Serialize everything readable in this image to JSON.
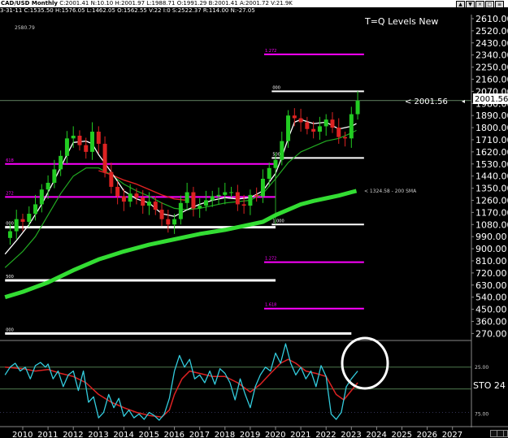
{
  "header": {
    "title": "CAD/USD  Monthly",
    "ohlc": "C:2001.41  N:10.10  H:2001.97  L:1988.71  O:1991.29  B:2001.41  A:2001.72  V:21.9K",
    "subline": "3-31-11  C:1535.50  H:1576.05  L:1462.05  O:1562.55  V:22 I:0  S:2522.37  R:114.00  N:-27.05",
    "window_buttons": [
      "▲",
      "▼",
      "×",
      "□",
      "≡"
    ]
  },
  "chart_data": {
    "type": "candlestick",
    "title": "T=Q Levels New",
    "corner_value": "2580.79",
    "price_label": "< 2001.56",
    "price_tag": "2001.56",
    "sma_label": "<  1324.58 - 200 SMA",
    "oscillator_label": "STO  24",
    "x_ticks": [
      "2010",
      "2011",
      "2012",
      "2013",
      "2014",
      "2015",
      "2016",
      "2017",
      "2018",
      "2019",
      "2020",
      "2021",
      "2022",
      "2023",
      "2024",
      "2025",
      "2026",
      "2027"
    ],
    "y_ticks": [
      2610,
      2520,
      2430,
      2340,
      2250,
      2160,
      2070,
      1980,
      1890,
      1800,
      1710,
      1620,
      1530,
      1440,
      1350,
      1260,
      1170,
      1080,
      990,
      900,
      810,
      720,
      630,
      540,
      450,
      360,
      270
    ],
    "ylim": [
      230,
      2640
    ],
    "osc_ticks": [
      "25.00",
      "75.00"
    ],
    "osc_ylim": [
      0,
      100
    ],
    "levels": [
      {
        "value": 2345,
        "x0": 2019.55,
        "x1": 2023.5,
        "color": "#ff00ff",
        "label": "1.272"
      },
      {
        "value": 2070,
        "x0": 2019.85,
        "x1": 2023.5,
        "color": "#ffffff",
        "label": "000"
      },
      {
        "value": 1575,
        "x0": 2019.85,
        "x1": 2023.5,
        "color": "#ffffff",
        "label": "500"
      },
      {
        "value": 1080,
        "x0": 2019.85,
        "x1": 2023.5,
        "color": "#ffffff",
        "label": "1.000"
      },
      {
        "value": 800,
        "x0": 2019.55,
        "x1": 2023.5,
        "color": "#ff00ff",
        "label": "1.272"
      },
      {
        "value": 455,
        "x0": 2019.55,
        "x1": 2023.5,
        "color": "#ff00ff",
        "label": "1.618"
      },
      {
        "value": 1530,
        "x0": 2009.3,
        "x1": 2020.0,
        "color": "#ff00ff",
        "label": "618"
      },
      {
        "value": 1285,
        "x0": 2009.3,
        "x1": 2020.0,
        "color": "#ff00ff",
        "label": "272"
      },
      {
        "value": 1060,
        "x0": 2009.3,
        "x1": 2020.0,
        "color": "#ffffff",
        "label": "000"
      },
      {
        "value": 665,
        "x0": 2009.3,
        "x1": 2020.0,
        "color": "#ffffff",
        "label": "500"
      },
      {
        "value": 270,
        "x0": 2009.3,
        "x1": 2023.0,
        "color": "#ffffff",
        "label": "000"
      }
    ],
    "close_series": [
      [
        2009.3,
        980
      ],
      [
        2009.5,
        1030
      ],
      [
        2009.75,
        1120
      ],
      [
        2010.0,
        1100
      ],
      [
        2010.25,
        1160
      ],
      [
        2010.5,
        1230
      ],
      [
        2010.75,
        1340
      ],
      [
        2011.0,
        1390
      ],
      [
        2011.25,
        1490
      ],
      [
        2011.5,
        1590
      ],
      [
        2011.75,
        1720
      ],
      [
        2012.0,
        1740
      ],
      [
        2012.25,
        1670
      ],
      [
        2012.5,
        1620
      ],
      [
        2012.75,
        1770
      ],
      [
        2013.0,
        1680
      ],
      [
        2013.25,
        1470
      ],
      [
        2013.5,
        1360
      ],
      [
        2013.75,
        1290
      ],
      [
        2014.0,
        1250
      ],
      [
        2014.25,
        1310
      ],
      [
        2014.5,
        1280
      ],
      [
        2014.75,
        1220
      ],
      [
        2015.0,
        1250
      ],
      [
        2015.25,
        1190
      ],
      [
        2015.5,
        1120
      ],
      [
        2015.75,
        1080
      ],
      [
        2016.0,
        1120
      ],
      [
        2016.25,
        1240
      ],
      [
        2016.5,
        1320
      ],
      [
        2016.75,
        1200
      ],
      [
        2017.0,
        1220
      ],
      [
        2017.25,
        1260
      ],
      [
        2017.5,
        1290
      ],
      [
        2017.75,
        1300
      ],
      [
        2018.0,
        1320
      ],
      [
        2018.25,
        1320
      ],
      [
        2018.5,
        1230
      ],
      [
        2018.75,
        1220
      ],
      [
        2019.0,
        1300
      ],
      [
        2019.25,
        1290
      ],
      [
        2019.5,
        1420
      ],
      [
        2019.75,
        1500
      ],
      [
        2020.0,
        1560
      ],
      [
        2020.25,
        1700
      ],
      [
        2020.5,
        1890
      ],
      [
        2020.75,
        1870
      ],
      [
        2021.0,
        1840
      ],
      [
        2021.25,
        1790
      ],
      [
        2021.5,
        1770
      ],
      [
        2021.75,
        1810
      ],
      [
        2022.0,
        1860
      ],
      [
        2022.25,
        1800
      ],
      [
        2022.5,
        1730
      ],
      [
        2022.75,
        1720
      ],
      [
        2023.0,
        1900
      ],
      [
        2023.25,
        2001
      ]
    ],
    "fast_ma": [
      [
        2009.3,
        860
      ],
      [
        2009.75,
        960
      ],
      [
        2010.25,
        1080
      ],
      [
        2010.75,
        1230
      ],
      [
        2011.25,
        1410
      ],
      [
        2011.75,
        1600
      ],
      [
        2012.0,
        1690
      ],
      [
        2012.5,
        1700
      ],
      [
        2012.75,
        1680
      ],
      [
        2013.0,
        1600
      ],
      [
        2013.5,
        1470
      ],
      [
        2014.0,
        1330
      ],
      [
        2014.5,
        1270
      ],
      [
        2015.0,
        1240
      ],
      [
        2015.5,
        1160
      ],
      [
        2016.0,
        1140
      ],
      [
        2016.5,
        1190
      ],
      [
        2017.0,
        1230
      ],
      [
        2017.5,
        1260
      ],
      [
        2018.0,
        1280
      ],
      [
        2018.5,
        1270
      ],
      [
        2019.0,
        1280
      ],
      [
        2019.5,
        1330
      ],
      [
        2020.0,
        1460
      ],
      [
        2020.25,
        1580
      ],
      [
        2020.5,
        1720
      ],
      [
        2020.75,
        1840
      ],
      [
        2021.0,
        1860
      ],
      [
        2021.5,
        1830
      ],
      [
        2022.0,
        1840
      ],
      [
        2022.5,
        1790
      ],
      [
        2023.0,
        1810
      ],
      [
        2023.2,
        1830
      ]
    ],
    "mid_ma": [
      [
        2009.3,
        760
      ],
      [
        2010.0,
        880
      ],
      [
        2010.5,
        990
      ],
      [
        2011.0,
        1150
      ],
      [
        2011.5,
        1310
      ],
      [
        2012.0,
        1440
      ],
      [
        2012.5,
        1500
      ],
      [
        2013.0,
        1500
      ],
      [
        2013.5,
        1450
      ],
      [
        2014.0,
        1380
      ],
      [
        2014.5,
        1330
      ],
      [
        2015.0,
        1290
      ],
      [
        2015.5,
        1240
      ],
      [
        2016.0,
        1200
      ],
      [
        2016.5,
        1190
      ],
      [
        2017.0,
        1200
      ],
      [
        2017.5,
        1220
      ],
      [
        2018.0,
        1240
      ],
      [
        2018.5,
        1250
      ],
      [
        2019.0,
        1260
      ],
      [
        2019.5,
        1310
      ],
      [
        2020.0,
        1420
      ],
      [
        2020.5,
        1540
      ],
      [
        2021.0,
        1620
      ],
      [
        2021.5,
        1660
      ],
      [
        2022.0,
        1700
      ],
      [
        2022.5,
        1720
      ],
      [
        2023.0,
        1760
      ],
      [
        2023.2,
        1780
      ]
    ],
    "slow_ma": [
      [
        2009.3,
        540
      ],
      [
        2010.0,
        580
      ],
      [
        2011.0,
        650
      ],
      [
        2012.0,
        740
      ],
      [
        2013.0,
        820
      ],
      [
        2014.0,
        880
      ],
      [
        2015.0,
        930
      ],
      [
        2016.0,
        970
      ],
      [
        2017.0,
        1010
      ],
      [
        2018.0,
        1040
      ],
      [
        2019.0,
        1080
      ],
      [
        2019.5,
        1100
      ],
      [
        2020.0,
        1150
      ],
      [
        2020.5,
        1190
      ],
      [
        2021.0,
        1230
      ],
      [
        2021.5,
        1255
      ],
      [
        2022.0,
        1275
      ],
      [
        2022.5,
        1295
      ],
      [
        2023.0,
        1320
      ],
      [
        2023.2,
        1330
      ]
    ],
    "red_ma": [
      [
        2013.0,
        1480
      ],
      [
        2013.5,
        1450
      ],
      [
        2014.0,
        1410
      ],
      [
        2014.5,
        1380
      ],
      [
        2015.0,
        1340
      ],
      [
        2015.5,
        1300
      ],
      [
        2016.0,
        1270
      ],
      [
        2016.5,
        1260
      ]
    ],
    "osc_k": [
      [
        2009.3,
        40
      ],
      [
        2009.5,
        30
      ],
      [
        2009.7,
        25
      ],
      [
        2009.9,
        35
      ],
      [
        2010.1,
        30
      ],
      [
        2010.3,
        45
      ],
      [
        2010.5,
        28
      ],
      [
        2010.7,
        24
      ],
      [
        2010.9,
        30
      ],
      [
        2011.0,
        26
      ],
      [
        2011.2,
        45
      ],
      [
        2011.4,
        35
      ],
      [
        2011.6,
        55
      ],
      [
        2011.8,
        40
      ],
      [
        2012.0,
        35
      ],
      [
        2012.2,
        60
      ],
      [
        2012.4,
        35
      ],
      [
        2012.6,
        75
      ],
      [
        2012.8,
        68
      ],
      [
        2013.0,
        95
      ],
      [
        2013.2,
        88
      ],
      [
        2013.4,
        65
      ],
      [
        2013.6,
        82
      ],
      [
        2013.8,
        70
      ],
      [
        2014.0,
        93
      ],
      [
        2014.2,
        85
      ],
      [
        2014.4,
        95
      ],
      [
        2014.6,
        90
      ],
      [
        2014.8,
        97
      ],
      [
        2015.0,
        88
      ],
      [
        2015.2,
        92
      ],
      [
        2015.4,
        98
      ],
      [
        2015.6,
        90
      ],
      [
        2015.8,
        70
      ],
      [
        2016.0,
        35
      ],
      [
        2016.2,
        15
      ],
      [
        2016.4,
        30
      ],
      [
        2016.6,
        20
      ],
      [
        2016.8,
        45
      ],
      [
        2017.0,
        40
      ],
      [
        2017.2,
        50
      ],
      [
        2017.4,
        35
      ],
      [
        2017.6,
        52
      ],
      [
        2017.8,
        32
      ],
      [
        2018.0,
        38
      ],
      [
        2018.2,
        50
      ],
      [
        2018.4,
        72
      ],
      [
        2018.6,
        45
      ],
      [
        2018.8,
        65
      ],
      [
        2019.0,
        82
      ],
      [
        2019.2,
        55
      ],
      [
        2019.4,
        40
      ],
      [
        2019.6,
        30
      ],
      [
        2019.8,
        35
      ],
      [
        2020.0,
        12
      ],
      [
        2020.2,
        25
      ],
      [
        2020.4,
        0
      ],
      [
        2020.6,
        25
      ],
      [
        2020.8,
        40
      ],
      [
        2021.0,
        30
      ],
      [
        2021.2,
        45
      ],
      [
        2021.4,
        35
      ],
      [
        2021.6,
        55
      ],
      [
        2021.8,
        28
      ],
      [
        2022.0,
        42
      ],
      [
        2022.2,
        90
      ],
      [
        2022.4,
        97
      ],
      [
        2022.6,
        88
      ],
      [
        2022.8,
        55
      ],
      [
        2023.0,
        45
      ],
      [
        2023.25,
        35
      ]
    ],
    "osc_d": [
      [
        2009.3,
        30
      ],
      [
        2010.0,
        32
      ],
      [
        2010.5,
        35
      ],
      [
        2011.0,
        33
      ],
      [
        2011.5,
        38
      ],
      [
        2012.0,
        42
      ],
      [
        2012.5,
        50
      ],
      [
        2013.0,
        65
      ],
      [
        2013.5,
        75
      ],
      [
        2014.0,
        82
      ],
      [
        2014.5,
        88
      ],
      [
        2015.0,
        92
      ],
      [
        2015.5,
        94
      ],
      [
        2015.8,
        85
      ],
      [
        2016.0,
        65
      ],
      [
        2016.3,
        45
      ],
      [
        2016.6,
        35
      ],
      [
        2017.0,
        38
      ],
      [
        2017.5,
        42
      ],
      [
        2018.0,
        42
      ],
      [
        2018.5,
        50
      ],
      [
        2019.0,
        62
      ],
      [
        2019.4,
        52
      ],
      [
        2019.8,
        38
      ],
      [
        2020.2,
        25
      ],
      [
        2020.5,
        20
      ],
      [
        2020.8,
        25
      ],
      [
        2021.2,
        35
      ],
      [
        2021.6,
        38
      ],
      [
        2022.0,
        42
      ],
      [
        2022.4,
        65
      ],
      [
        2022.7,
        72
      ],
      [
        2023.0,
        60
      ],
      [
        2023.25,
        50
      ]
    ]
  }
}
